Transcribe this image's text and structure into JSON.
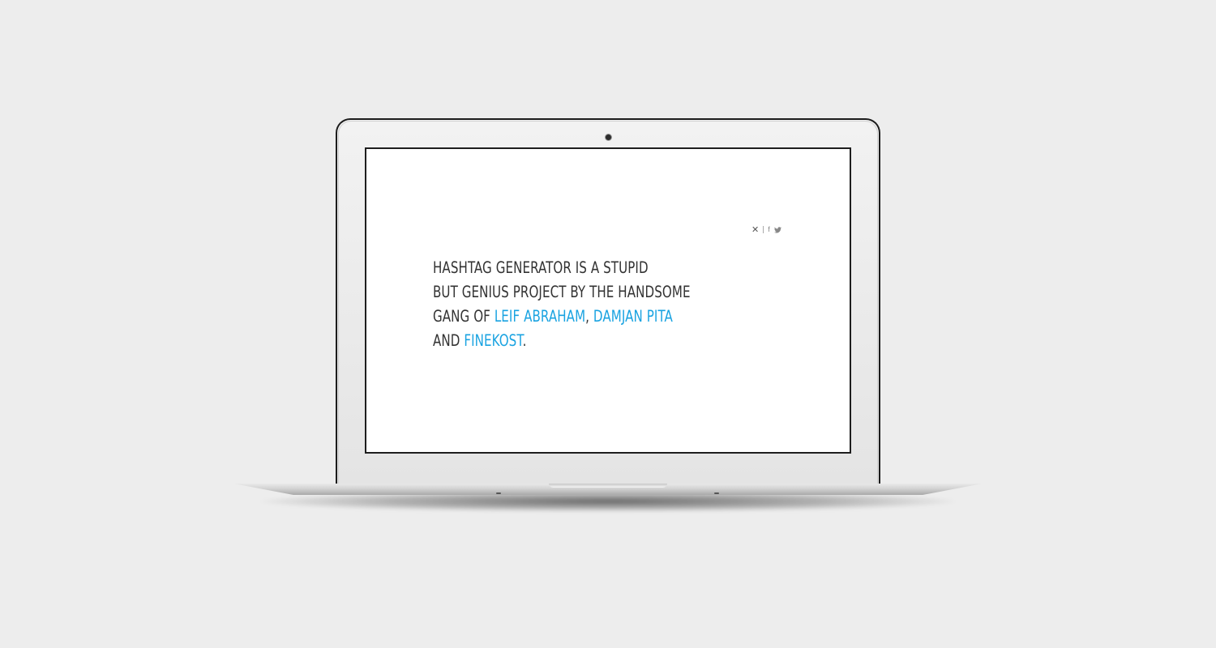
{
  "device": {
    "type": "laptop",
    "colors": {
      "background": "#ededed",
      "screen_background": "#ffffff",
      "bezel": "#e8e8e8",
      "outline": "#1c1c1c"
    }
  },
  "share_bar": {
    "close_icon": "close-icon",
    "facebook_icon": "facebook-icon",
    "facebook_glyph": "f",
    "twitter_icon": "twitter-icon"
  },
  "intro": {
    "line1": "HASHTAG GENERATOR IS A STUPID",
    "line2": "BUT GENIUS PROJECT BY THE HANDSOME",
    "line3_prefix": "GANG OF ",
    "link_leif": "LEIF ABRAHAM",
    "comma": ", ",
    "link_damjan": "DAMJAN PITA",
    "line4_prefix": "AND ",
    "link_finekost": "FINEKOST",
    "period": ".",
    "text_color": "#333333",
    "link_color": "#1aa3e1"
  }
}
